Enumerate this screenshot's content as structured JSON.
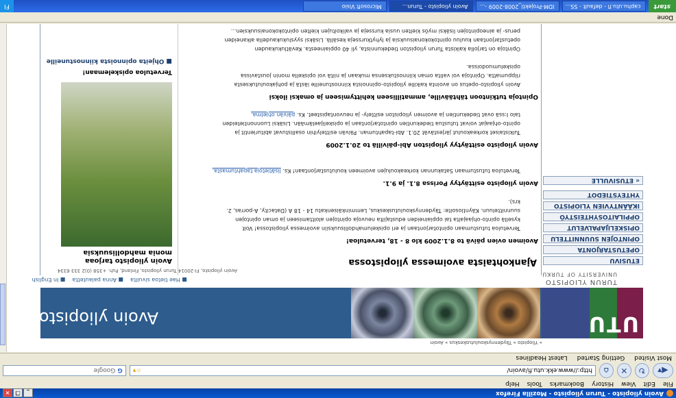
{
  "window": {
    "title": "Avoin yliopisto - Turun yliopisto - Mozilla Firefox",
    "controls": [
      "_",
      "❐",
      "×"
    ]
  },
  "menu": [
    "File",
    "Edit",
    "View",
    "History",
    "Bookmarks",
    "Tools",
    "Help"
  ],
  "nav": {
    "url": "http://www.ekk.utu.fi/avoin/",
    "search_placeholder": "Google"
  },
  "bookmarks": [
    "Most Visited",
    "Getting Started",
    "Latest Headlines"
  ],
  "status": "Done",
  "taskbar": {
    "start": "start",
    "tasks": [
      "caphu.utu.fi - default - SS...",
      "IDM-Projekti_2008-2009 -...",
      "Avoin yliopisto - Turun...",
      "Microsoft Visio"
    ],
    "tray_lang": "FI"
  },
  "page": {
    "breadcrumb": "» Yliopisto » Täydennyskoulutuskeskus » Avoin",
    "site_title": "Avoin yliopisto",
    "logo_word": "UTU",
    "logo_uni": "TURUN YLIOPISTO",
    "logo_uni_en": "UNIVERSITY OF TURKU",
    "top_links": [
      "Hae tietoa sivuilta",
      "Anna palautetta",
      "In English"
    ],
    "address": "Avoin yliopisto, FI-20014 Turun yliopisto, Finland, Puh. +358 (0)2 333 6334",
    "left_nav": [
      "ETUSIVU",
      "OPETUSTARJONTA",
      "OPINTOJEN SUUNNITTELU",
      "OPISKELIJAPALVELUT",
      "OPPILAITOSYHTEISTYÖ",
      "IKÄÄNTYVIEN YLIOPISTO",
      "YHTEYSTIEDOT",
      "« ETUSIVULLE"
    ],
    "heading": "Ajankohtaista avoimessa yliopistossa",
    "items": [
      {
        "title": "Avoimen ovien päivä to 8.1.2009 klo 8 - 18, tervetuloa!",
        "lines": [
          "Tervetuloa tutustumaan opintotarjontaan ja eri opiskelumahdollisuuksiin avoimessa yliopistossa! Voit",
          "kysellä opinto-ohjaajalta tai oppiaineiden edustajilta neuvoja opintojen aloittamiseen ja oman opintojen",
          "suunnitteluun. Käyntiosoite: Täydennyskoulutuskeskus, Lemminkäisenkatu 14 - 18 A (Datacity, A-porras, 2.",
          "krs)."
        ],
        "link": ""
      },
      {
        "title": "Avoin yliopisto esittäytyy Porissa 8.1. ja 9.1.",
        "lines": [
          "Tervetuloa tutustumaan Satakunnan korkeakoulujen avoimeen koulutustarjontaan! Ks."
        ],
        "link": "lisätietoja tapahtumasta."
      },
      {
        "title": "Avoin yliopisto esittäytyy yliopiston Abi-päivillä to 20.1.2009",
        "lines": [
          "Tulkistaiset korkeakoulut järjestävät 20.1. Abi-tapahtuman. Päivän esittelyihin osallistuvat abiturientit ja",
          "opinto-ohjaajat voivat tutustua tiedekuntien opintotarjontaan ja opiskelijaelämään. Lisäksi Luonnontieteiden",
          "talo I:ssä ovat tiedekuntien ja avoimen yliopiston esittely- ja neuvontapisteet. Ks."
        ],
        "link": "päivän ohjelma."
      },
      {
        "title": "Opintoja tutkintoon tähtääville, ammatilliseen kehittymiseen ja omaksi iloksi",
        "lines": [
          "Avoin yliopisto-opetus on avointa kaikille yliopisto-opinnoista kiinnostuneille iästä ja pohjakoulutuksesta",
          "riippumatta. Opintoja voi valita oman kiinnostuksensa mukaan ja niitä voi opiskella monin joustavissa",
          "opiskelumuodoissa.",
          "",
          "Opintoja on tarjolla kaikista Turun yliopiston tiedekunnista, yli 40 oppiaineesta. Kevätlukukauden",
          "opetustarjontaan kuuluu opintokokonaisuuksia ja lyhytkursseja kesällä. Lisäksi syyslukukaudella alkaneiden",
          "perus- ja aineopintojen lisäksi myös kielten uusia kursseja ja valikoitujen kielten opintokokonaisuuksien..."
        ],
        "link": ""
      }
    ],
    "right": {
      "title1": "Avoin yliopisto tarjoaa",
      "title2": "monia mahdollisuuksia",
      "caption": "Tervetuloa opiskelemaan!",
      "link": "Ohjeita opinnoista kiinnostuneille"
    }
  }
}
